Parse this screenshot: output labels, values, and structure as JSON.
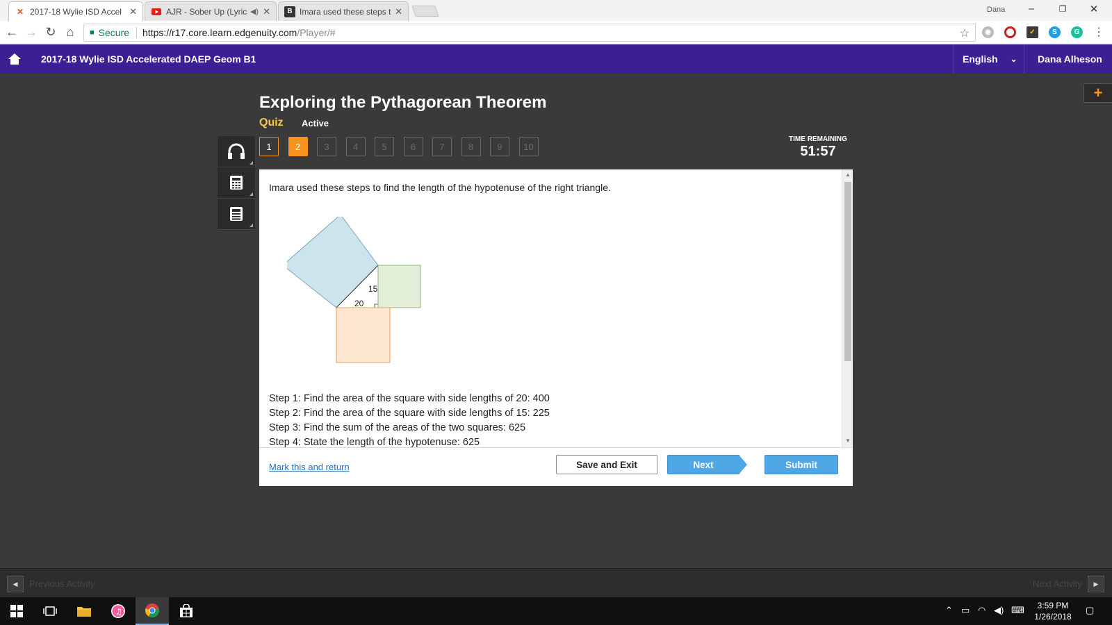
{
  "browser": {
    "tabs": [
      {
        "title": "2017-18 Wylie ISD Accel",
        "icon": "edgenuity-x-icon",
        "active": true
      },
      {
        "title": "AJR - Sober Up (Lyrics",
        "icon": "youtube-icon",
        "active": false,
        "audio": true
      },
      {
        "title": "Imara used these steps to",
        "icon": "brainly-icon",
        "active": false
      }
    ],
    "profile_name": "Dana",
    "address": {
      "secure_label": "Secure",
      "url_host": "https://r17.core.learn.edgenuity.com",
      "url_path": "/Player/#"
    },
    "colors": {
      "accent_tab_x": "#e8501c",
      "youtube": "#e62117",
      "secure": "#0b8043"
    }
  },
  "header": {
    "course_title": "2017-18 Wylie ISD Accelerated DAEP Geom B1",
    "language": "English",
    "user_name": "Dana Alheson",
    "color": "#3d1f94"
  },
  "activity": {
    "title": "Exploring the Pythagorean Theorem",
    "type": "Quiz",
    "status": "Active",
    "questions": [
      "1",
      "2",
      "3",
      "4",
      "5",
      "6",
      "7",
      "8",
      "9",
      "10"
    ],
    "current_question": 2,
    "completed_questions": [
      1
    ],
    "timer_label": "TIME REMAINING",
    "timer_value": "51:57",
    "accent": "#f7941d"
  },
  "tools": [
    "headphones-icon",
    "calculator-icon",
    "scientific-calculator-icon"
  ],
  "question": {
    "prompt": "Imara used these steps to find the length of the hypotenuse of the right triangle.",
    "figure": {
      "leg_short_label": "15",
      "leg_long_label": "20",
      "square_colors": {
        "hypotenuse": "#cce4ec",
        "short_leg": "#e3efd9",
        "long_leg": "#fde6d2"
      }
    },
    "steps": [
      "Step 1: Find the area of the square with side lengths of 20: 400",
      "Step 2: Find the area of the square with side lengths of 15: 225",
      "Step 3: Find the sum of the areas of the two squares: 625",
      "Step 4: State the length of the hypotenuse: 625"
    ]
  },
  "footer": {
    "mark_link": "Mark this and return",
    "save_exit": "Save and Exit",
    "next": "Next",
    "submit": "Submit"
  },
  "activity_nav": {
    "previous": "Previous Activity",
    "next": "Next Activity"
  },
  "taskbar": {
    "time": "3:59 PM",
    "date": "1/26/2018"
  }
}
